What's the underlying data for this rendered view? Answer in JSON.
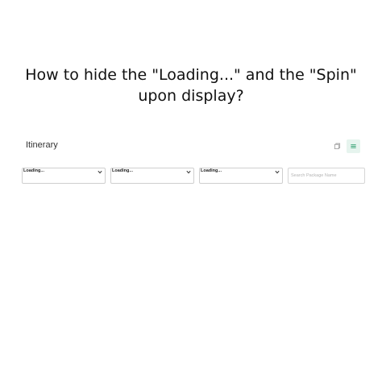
{
  "headline": {
    "line1": "How to hide the \"Loading...\" and the \"Spin\"",
    "line2": "upon display?"
  },
  "section": {
    "title": "Itinerary"
  },
  "view_toggle": {
    "grid_icon": "copy-icon",
    "list_icon": "list-icon",
    "active": "list",
    "accent_color": "#2e9e6e"
  },
  "filters": [
    {
      "label": "Loading...",
      "icon": "chevron-down-icon"
    },
    {
      "label": "Loading...",
      "icon": "chevron-down-icon"
    },
    {
      "label": "Loading...",
      "icon": "chevron-down-icon"
    }
  ],
  "search": {
    "placeholder": "Search Package Name",
    "value": ""
  }
}
